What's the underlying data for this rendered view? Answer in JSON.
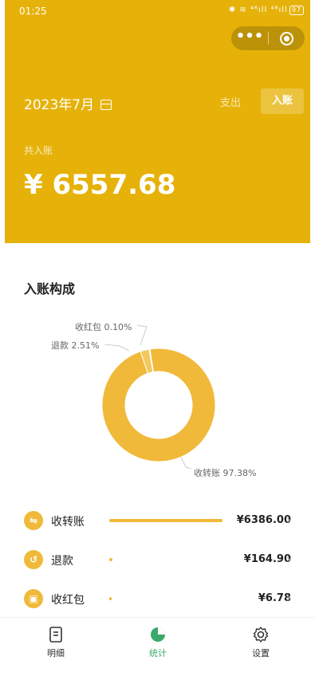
{
  "status_bar": {
    "time": "01:25",
    "icons": "✱ ≋ ⁴⁶ıll ⁴⁶ıll",
    "battery": "97"
  },
  "header": {
    "month": "2023年7月",
    "tab_expense": "支出",
    "tab_income": "入账",
    "total_label": "共入账",
    "total_amount": "¥ 6557.68",
    "color": "#e6b20a"
  },
  "section": {
    "title": "入账构成"
  },
  "chart_data": {
    "type": "pie",
    "donut": true,
    "slices": [
      {
        "label": "收转账",
        "percent": 97.38,
        "color": "#f0b93a"
      },
      {
        "label": "退款",
        "percent": 2.51,
        "color": "#f3c95e"
      },
      {
        "label": "收红包",
        "percent": 0.1,
        "color": "#f7d98a"
      }
    ],
    "annotations": [
      "收红包 0.10%",
      "退款 2.51%",
      "收转账 97.38%"
    ]
  },
  "list": [
    {
      "icon": "transfer-icon",
      "glyph": "⇋",
      "name": "收转账",
      "amount": "¥6386.00",
      "ratio": 0.9738
    },
    {
      "icon": "refund-icon",
      "glyph": "↺",
      "name": "退款",
      "amount": "¥164.90",
      "ratio": 0.0251
    },
    {
      "icon": "red-packet-icon",
      "glyph": "▣",
      "name": "收红包",
      "amount": "¥6.78",
      "ratio": 0.001
    }
  ],
  "tabbar": {
    "detail": "明细",
    "stats": "统计",
    "settings": "设置",
    "active_color": "#3aa96b"
  }
}
